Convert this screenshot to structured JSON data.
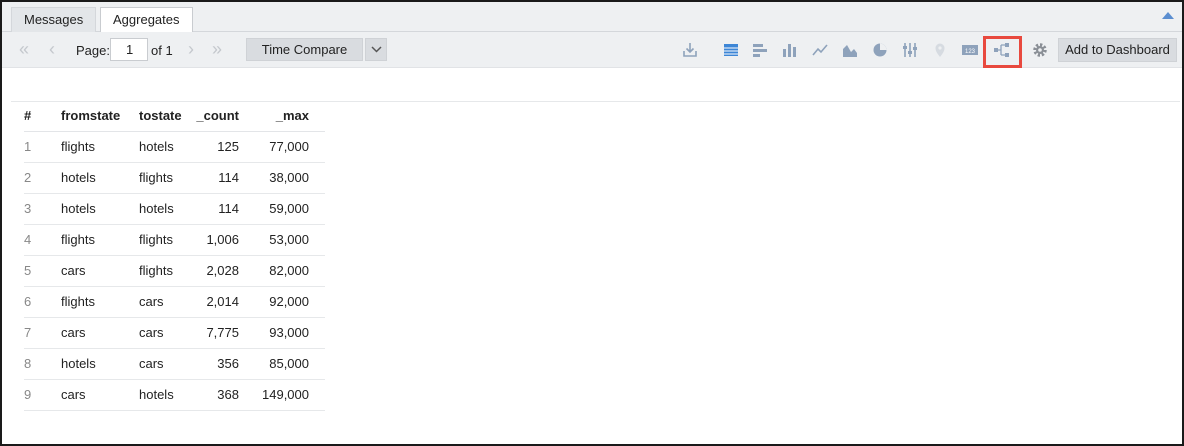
{
  "tabs": [
    {
      "label": "Messages"
    },
    {
      "label": "Aggregates"
    }
  ],
  "toolbar": {
    "page_label": "Page:",
    "page_value": "1",
    "page_of": "of 1",
    "time_compare_label": "Time Compare",
    "add_to_dashboard_label": "Add to Dashboard",
    "icons": [
      "first-page-icon",
      "prev-page-icon",
      "next-page-icon",
      "last-page-icon",
      "download-icon",
      "table-view-icon",
      "bar-chart-icon",
      "column-chart-icon",
      "line-chart-icon",
      "area-chart-icon",
      "pie-chart-icon",
      "filters-icon",
      "map-icon",
      "single-value-icon",
      "flow-diagram-icon",
      "gear-icon"
    ],
    "selected_icon": "table-view-icon",
    "highlighted_icon": "flow-diagram-icon"
  },
  "colors": {
    "accent": "#5b8ed0",
    "highlight": "#e8493e",
    "toolbar_bg": "#eef0f2"
  },
  "table": {
    "headers": [
      "#",
      "fromstate",
      "tostate",
      "_count",
      "_max"
    ],
    "rows": [
      [
        "1",
        "flights",
        "hotels",
        "125",
        "77,000"
      ],
      [
        "2",
        "hotels",
        "flights",
        "114",
        "38,000"
      ],
      [
        "3",
        "hotels",
        "hotels",
        "114",
        "59,000"
      ],
      [
        "4",
        "flights",
        "flights",
        "1,006",
        "53,000"
      ],
      [
        "5",
        "cars",
        "flights",
        "2,028",
        "82,000"
      ],
      [
        "6",
        "flights",
        "cars",
        "2,014",
        "92,000"
      ],
      [
        "7",
        "cars",
        "cars",
        "7,775",
        "93,000"
      ],
      [
        "8",
        "hotels",
        "cars",
        "356",
        "85,000"
      ],
      [
        "9",
        "cars",
        "hotels",
        "368",
        "149,000"
      ]
    ]
  }
}
